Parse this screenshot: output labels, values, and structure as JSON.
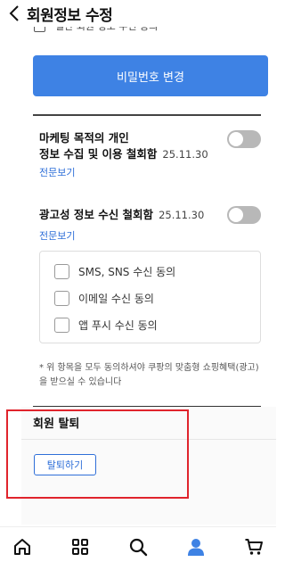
{
  "header": {
    "title": "회원정보 수정"
  },
  "partial_row": {
    "text": "일반 회원 정보 수신 동의"
  },
  "password_button": {
    "label": "비밀번호 변경"
  },
  "marketing": {
    "title_line1": "마케팅 목적의 개인",
    "title_line2": "정보 수집 및 이용 철회함",
    "date": "25.11.30",
    "link": "전문보기",
    "toggle_on": false
  },
  "ads": {
    "title": "광고성 정보 수신 철회함",
    "date": "25.11.30",
    "link": "전문보기",
    "toggle_on": false
  },
  "consents": [
    {
      "label": "SMS, SNS 수신 동의",
      "checked": false
    },
    {
      "label": "이메일 수신 동의",
      "checked": false
    },
    {
      "label": "앱 푸시 수신 동의",
      "checked": false
    }
  ],
  "note": "* 위 항목을 모두 동의하셔야 쿠팡의 맞춤형 쇼핑혜택(광고)을 받으실 수 있습니다",
  "withdraw": {
    "title": "회원 탈퇴",
    "button": "탈퇴하기"
  },
  "tabbar": {
    "items": [
      {
        "name": "home",
        "icon": "home-icon"
      },
      {
        "name": "categories",
        "icon": "grid-icon"
      },
      {
        "name": "search",
        "icon": "search-icon"
      },
      {
        "name": "my-page",
        "icon": "person-icon",
        "active": true
      },
      {
        "name": "cart",
        "icon": "cart-icon"
      }
    ],
    "active_color": "#3e82e4"
  },
  "colors": {
    "accent": "#3e82e4",
    "link": "#2f6fd8",
    "highlight": "#e0242c"
  }
}
